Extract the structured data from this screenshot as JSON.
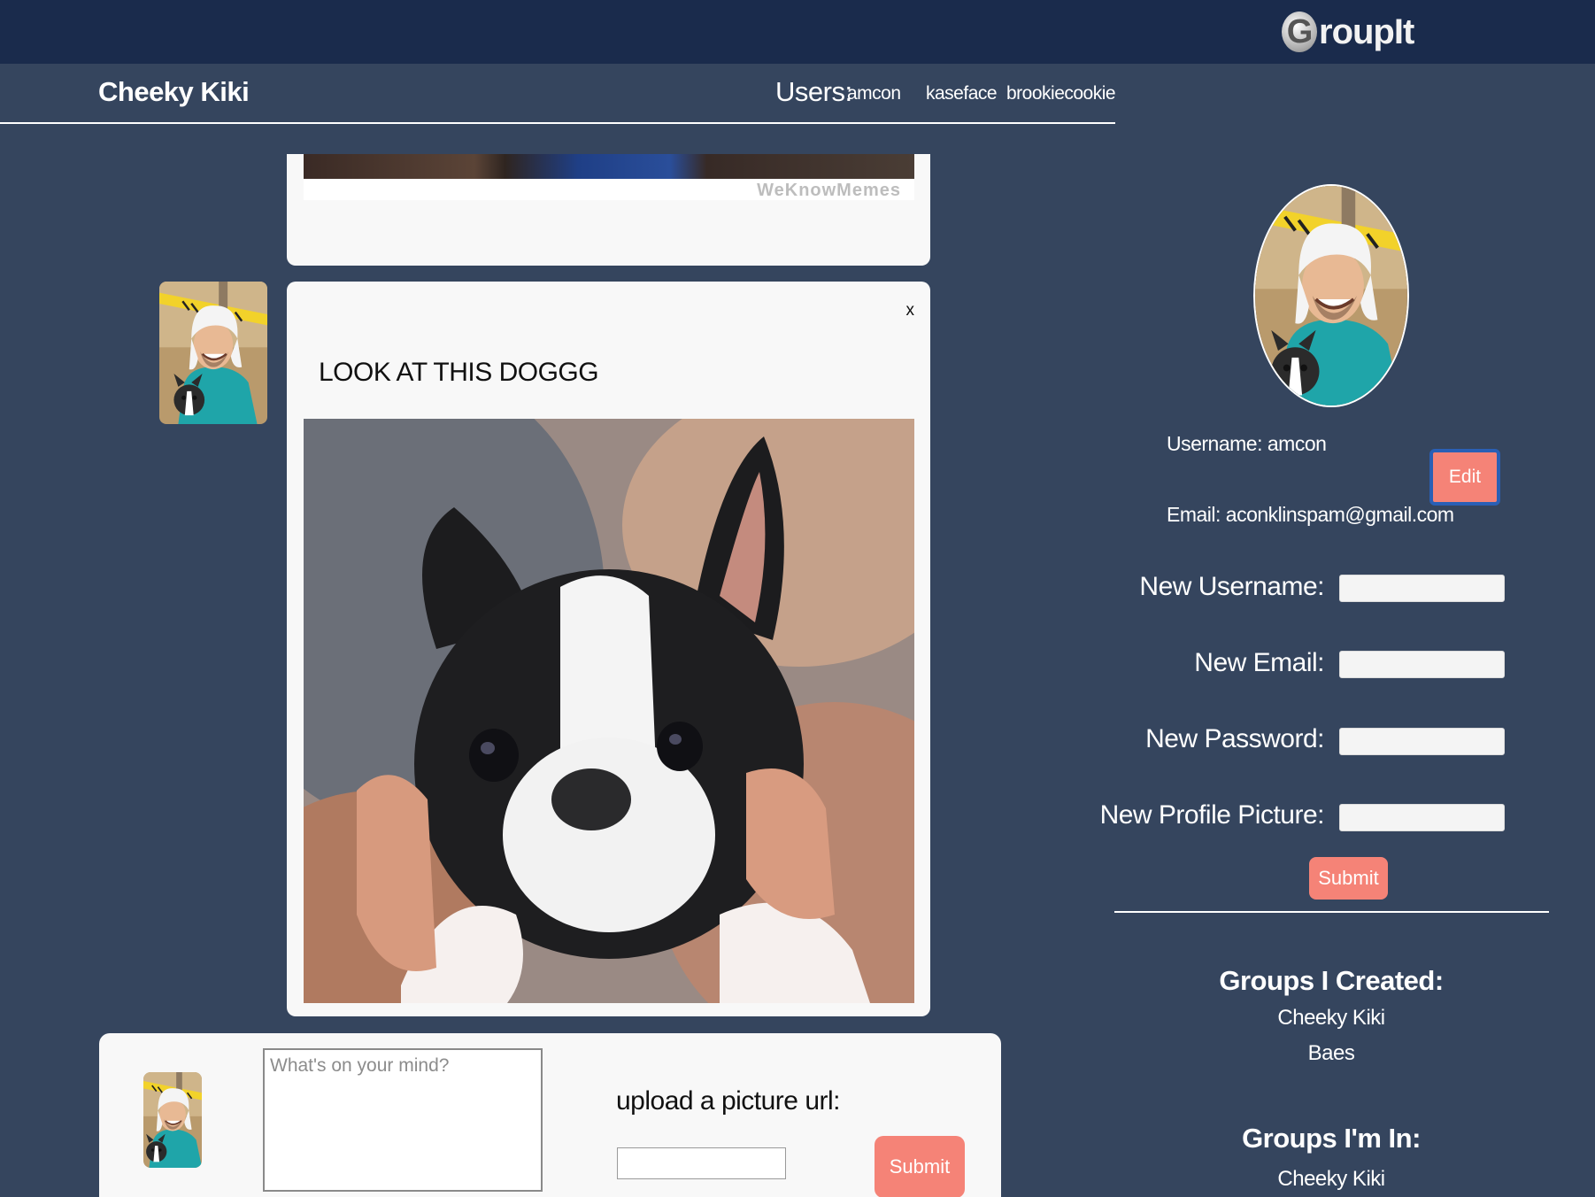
{
  "app": {
    "brand_initial": "G",
    "brand_rest": "roupIt"
  },
  "header": {
    "group_name": "Cheeky Kiki",
    "users_label": "Users:",
    "users": [
      "amcon",
      "kaseface",
      "brookiecookie"
    ]
  },
  "feed": {
    "posts": [
      {
        "image_watermark": "WeKnowMemes"
      },
      {
        "close_label": "x",
        "text": "LOOK AT THIS DOGGG"
      }
    ]
  },
  "composer": {
    "textarea_placeholder": "What's on your mind?",
    "upload_label": "upload a picture url:",
    "submit_label": "Submit"
  },
  "profile": {
    "username_line": "Username: amcon",
    "email_line": "Email: aconklinspam@gmail.com",
    "edit_label": "Edit",
    "form": {
      "new_username_label": "New Username:",
      "new_email_label": "New Email:",
      "new_password_label": "New Password:",
      "new_picture_label": "New Profile Picture:",
      "submit_label": "Submit"
    },
    "groups_created_heading": "Groups I Created:",
    "groups_created": [
      "Cheeky Kiki",
      "Baes"
    ],
    "groups_in_heading": "Groups I'm In:",
    "groups_in": [
      "Cheeky Kiki"
    ]
  },
  "colors": {
    "page_bg": "#35455e",
    "topbar_bg": "#1a2b4c",
    "accent": "#f58377",
    "focus_ring": "#2a5fb5",
    "card_bg": "#f8f8f8"
  }
}
